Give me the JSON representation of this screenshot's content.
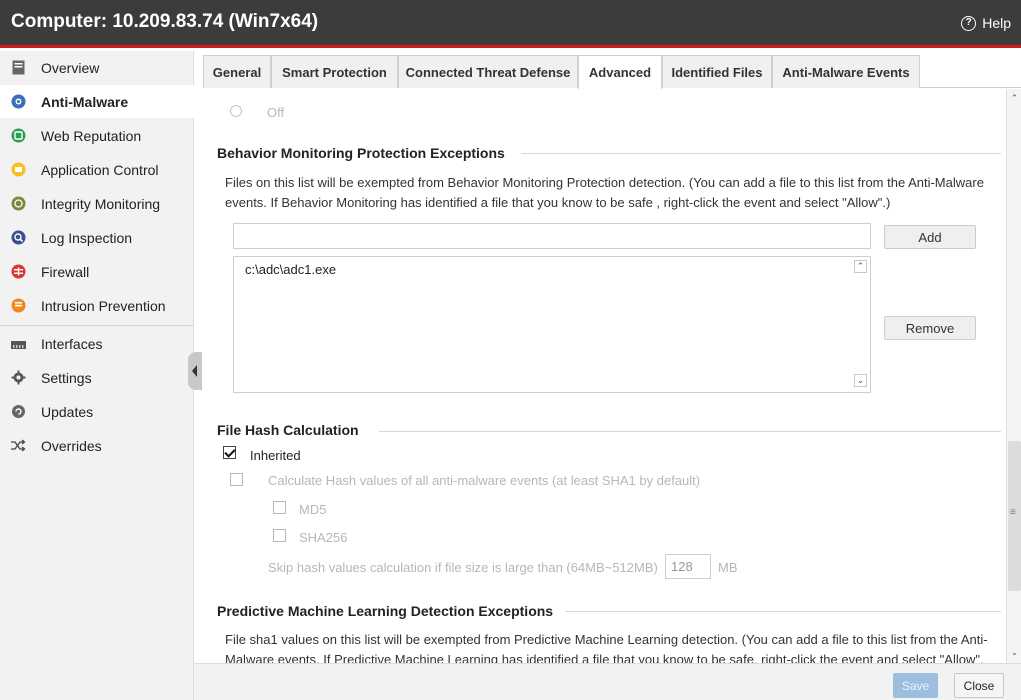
{
  "window": {
    "title": "Computer: 10.209.83.74 (Win7x64)",
    "help_label": "Help",
    "accent_color": "#d71920"
  },
  "sidebar": {
    "items": [
      {
        "label": "Overview",
        "icon": "overview-icon"
      },
      {
        "label": "Anti-Malware",
        "icon": "anti-malware-icon",
        "active": true
      },
      {
        "label": "Web Reputation",
        "icon": "web-reputation-icon"
      },
      {
        "label": "Application Control",
        "icon": "application-control-icon"
      },
      {
        "label": "Integrity Monitoring",
        "icon": "integrity-monitoring-icon"
      },
      {
        "label": "Log Inspection",
        "icon": "log-inspection-icon"
      },
      {
        "label": "Firewall",
        "icon": "firewall-icon"
      },
      {
        "label": "Intrusion Prevention",
        "icon": "intrusion-prevention-icon"
      },
      {
        "label": "Interfaces",
        "icon": "interfaces-icon"
      },
      {
        "label": "Settings",
        "icon": "settings-gear-icon"
      },
      {
        "label": "Updates",
        "icon": "updates-icon"
      },
      {
        "label": "Overrides",
        "icon": "overrides-shuffle-icon"
      }
    ]
  },
  "tabs": [
    {
      "label": "General"
    },
    {
      "label": "Smart Protection"
    },
    {
      "label": "Connected Threat Defense"
    },
    {
      "label": "Advanced",
      "active": true
    },
    {
      "label": "Identified Files"
    },
    {
      "label": "Anti-Malware Events"
    }
  ],
  "content": {
    "off_option": "Off",
    "behavior": {
      "title": "Behavior Monitoring Protection Exceptions",
      "desc_line1": "Files on this list will be exempted from Behavior Monitoring Protection detection. (You can add a file to this list from the Anti-Malware",
      "desc_line2": "events. If Behavior Monitoring has identified a file that you know to be safe , right-click the event and select \"Allow\".)",
      "input_value": "",
      "add_label": "Add",
      "list_items": [
        "c:\\adc\\adc1.exe"
      ],
      "remove_label": "Remove"
    },
    "hash": {
      "title": "File Hash Calculation",
      "inherited_label": "Inherited",
      "inherited_checked": true,
      "calc_label": "Calculate Hash values of all anti-malware events (at least SHA1 by default)",
      "md5_label": "MD5",
      "sha256_label": "SHA256",
      "skip_label": "Skip hash values calculation if file size is large than (64MB~512MB)",
      "skip_value": "128",
      "skip_unit": "MB"
    },
    "pml": {
      "title": "Predictive Machine Learning Detection Exceptions",
      "desc_line1": "File sha1 values on this list will be exempted from Predictive Machine Learning detection. (You can add a file to this list from the Anti-",
      "desc_line2": "Malware events. If Predictive Machine Learning has identified a file that you know to be safe, right-click the event and select \"Allow\"."
    }
  },
  "footer": {
    "save_label": "Save",
    "close_label": "Close"
  }
}
